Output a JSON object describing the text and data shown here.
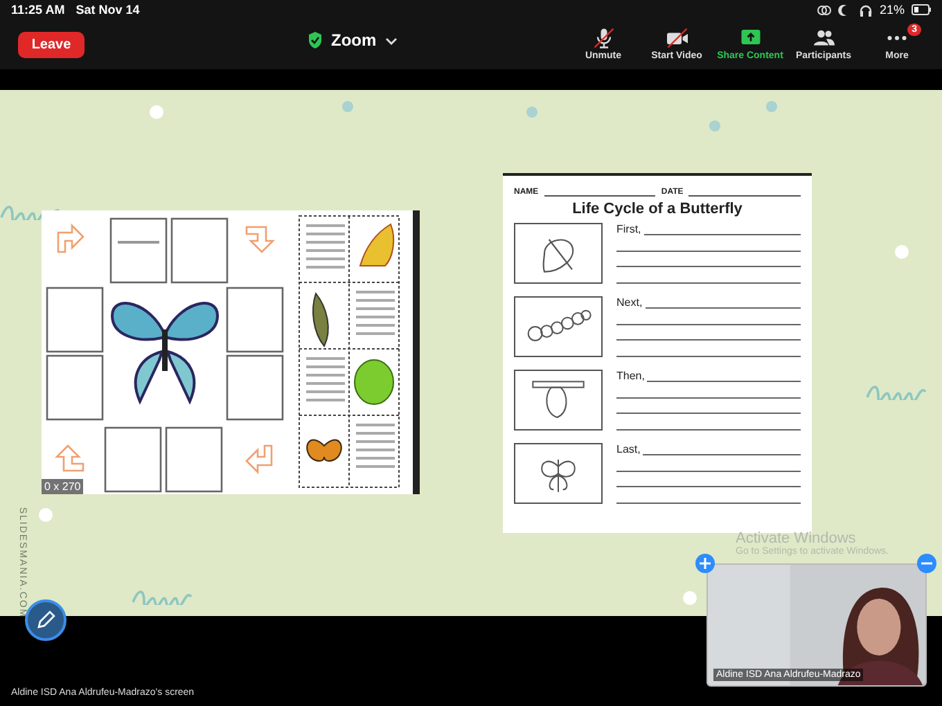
{
  "status_bar": {
    "time": "11:25 AM",
    "date": "Sat Nov 14",
    "battery": "21%"
  },
  "toolbar": {
    "leave": "Leave",
    "meeting_title": "Zoom",
    "buttons": [
      {
        "label": "Unmute",
        "kind": "mic-off"
      },
      {
        "label": "Start Video",
        "kind": "video-off"
      },
      {
        "label": "Share Content",
        "kind": "share"
      },
      {
        "label": "Participants",
        "kind": "participants"
      },
      {
        "label": "More",
        "kind": "more",
        "badge": "3"
      }
    ]
  },
  "shared_slide": {
    "credit": "SLIDESMANIA.COM",
    "left_worksheet": {
      "size_label": "0 x 270"
    },
    "right_worksheet": {
      "name_label": "NAME",
      "date_label": "DATE",
      "title": "Life Cycle of a Butterfly",
      "stages": [
        {
          "label": "First,",
          "kind": "leaf"
        },
        {
          "label": "Next,",
          "kind": "caterpillar"
        },
        {
          "label": "Then,",
          "kind": "chrysalis"
        },
        {
          "label": "Last,",
          "kind": "butterfly"
        }
      ]
    }
  },
  "os_notice": {
    "title": "Activate Windows",
    "subtitle": "Go to Settings to activate Windows."
  },
  "self_view": {
    "name": "Aldine ISD Ana Aldrufeu-Madrazo",
    "kind": "picture"
  },
  "screen_owner": "Aldine ISD Ana Aldrufeu-Madrazo's screen"
}
